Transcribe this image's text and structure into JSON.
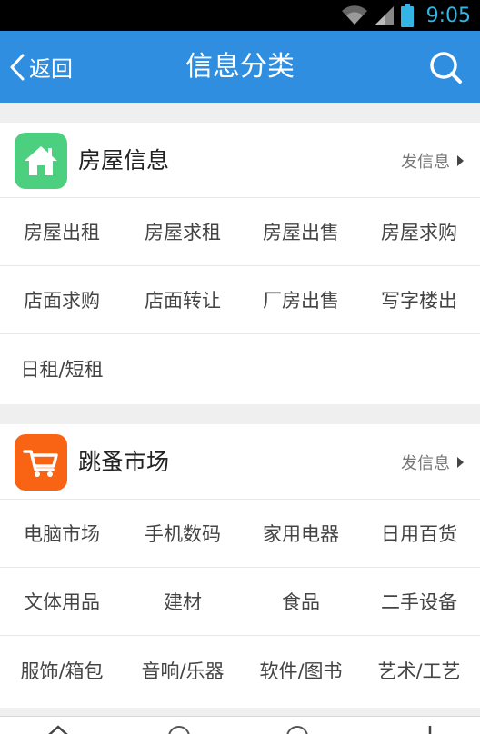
{
  "status": {
    "time": "9:05"
  },
  "header": {
    "back_label": "返回",
    "title": "信息分类"
  },
  "sections": [
    {
      "title": "房屋信息",
      "post_label": "发信息",
      "icon": "house-icon",
      "icon_color": "#4ccf7f",
      "rows": [
        [
          "房屋出租",
          "房屋求租",
          "房屋出售",
          "房屋求购"
        ],
        [
          "店面求购",
          "店面转让",
          "厂房出售",
          "写字楼出"
        ],
        [
          "日租/短租"
        ]
      ]
    },
    {
      "title": "跳蚤市场",
      "post_label": "发信息",
      "icon": "shopping-cart-icon",
      "icon_color": "#f96414",
      "rows": [
        [
          "电脑市场",
          "手机数码",
          "家用电器",
          "日用百货"
        ],
        [
          "文体用品",
          "建材",
          "食品",
          "二手设备"
        ],
        [
          "服饰/箱包",
          "音响/乐器",
          "软件/图书",
          "艺术/工艺"
        ]
      ]
    }
  ],
  "colors": {
    "header": "#2f8ee0",
    "status_time": "#33b5e5"
  }
}
